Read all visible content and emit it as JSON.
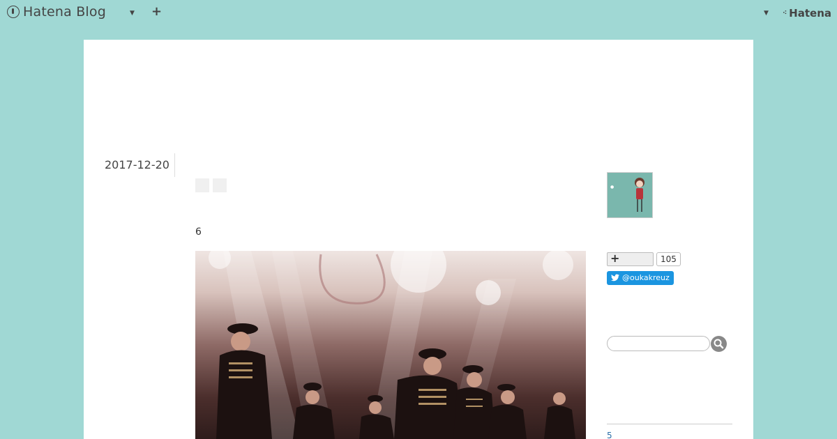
{
  "header": {
    "brand": "Hatena Blog",
    "right_brand": "Hatena",
    "icons": [
      "hatena-blog-logo-icon",
      "caret-down-icon",
      "plus-icon",
      "hatena-logo-icon"
    ]
  },
  "entry": {
    "date": "2017-12-20",
    "number": "6",
    "photo_icon": "stage-photo"
  },
  "sidebar": {
    "follow_count": "105",
    "twitter_label": "@oukakreuz",
    "search_placeholder": "",
    "link_text": "5"
  },
  "colors": {
    "background": "#a0d8d4",
    "panel": "#ffffff",
    "twitter": "#1b95e0",
    "link": "#2a6fa8"
  }
}
